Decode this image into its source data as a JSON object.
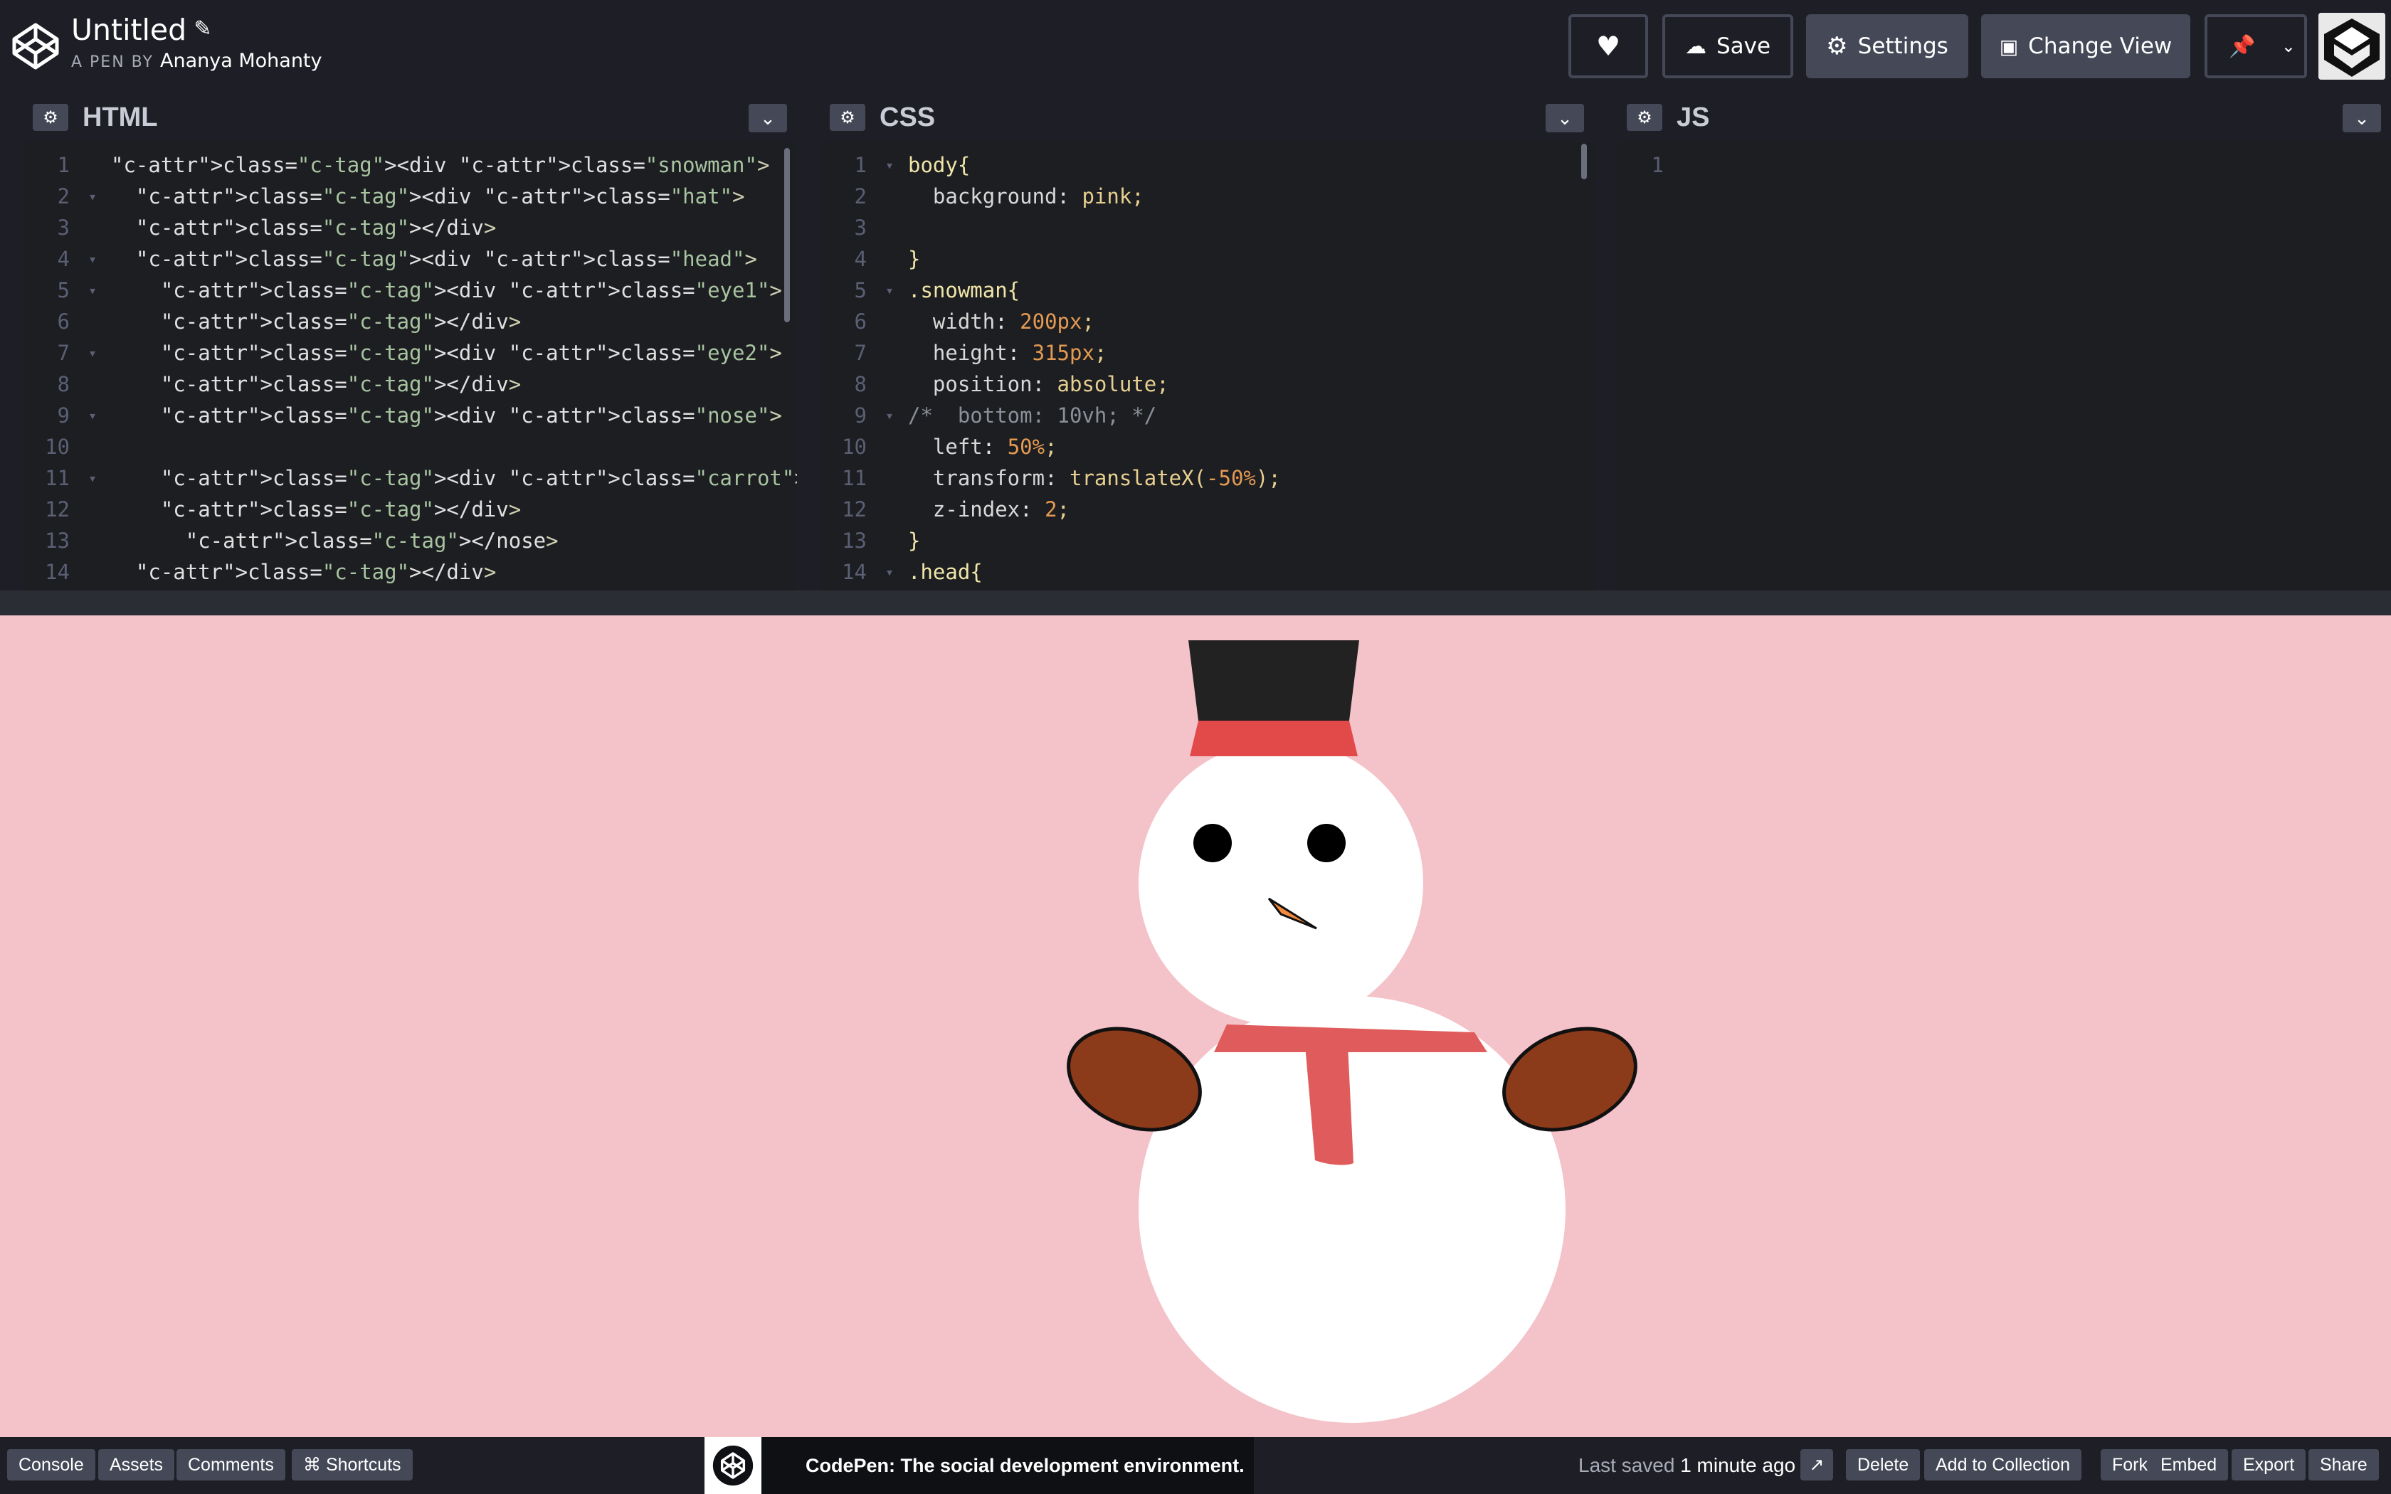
{
  "header": {
    "title": "Untitled",
    "byline_prefix": "A PEN BY",
    "author": "Ananya Mohanty",
    "buttons": {
      "save": "Save",
      "settings": "Settings",
      "change_view": "Change View"
    },
    "icons": [
      "heart-icon",
      "cloud-icon",
      "gear-icon",
      "eye-icon",
      "pin-icon",
      "chevron-down-icon"
    ]
  },
  "panes": {
    "html": {
      "title": "HTML",
      "lines": [
        {
          "n": "1",
          "fold": "",
          "t": "<div class=\"snowman\">"
        },
        {
          "n": "2",
          "fold": "▾",
          "t": "  <div class=\"hat\">"
        },
        {
          "n": "3",
          "fold": "",
          "t": "  </div>"
        },
        {
          "n": "4",
          "fold": "▾",
          "t": "  <div class=\"head\">"
        },
        {
          "n": "5",
          "fold": "▾",
          "t": "    <div class=\"eye1\">"
        },
        {
          "n": "6",
          "fold": "",
          "t": "    </div>"
        },
        {
          "n": "7",
          "fold": "▾",
          "t": "    <div class=\"eye2\">"
        },
        {
          "n": "8",
          "fold": "",
          "t": "    </div>"
        },
        {
          "n": "9",
          "fold": "▾",
          "t": "    <div class=\"nose\">"
        },
        {
          "n": "10",
          "fold": "",
          "t": ""
        },
        {
          "n": "11",
          "fold": "▾",
          "t": "    <div class=\"carrot\">"
        },
        {
          "n": "12",
          "fold": "",
          "t": "    </div>"
        },
        {
          "n": "13",
          "fold": "",
          "t": "      </nose>"
        },
        {
          "n": "14",
          "fold": "",
          "t": "  </div>"
        }
      ]
    },
    "css": {
      "title": "CSS",
      "lines": [
        {
          "n": "1",
          "fold": "▾",
          "t": "body{"
        },
        {
          "n": "2",
          "fold": "",
          "t": "  background: pink;"
        },
        {
          "n": "3",
          "fold": "",
          "t": ""
        },
        {
          "n": "4",
          "fold": "",
          "t": "}"
        },
        {
          "n": "5",
          "fold": "▾",
          "t": ".snowman{"
        },
        {
          "n": "6",
          "fold": "",
          "t": "  width: 200px;"
        },
        {
          "n": "7",
          "fold": "",
          "t": "  height: 315px;"
        },
        {
          "n": "8",
          "fold": "",
          "t": "  position: absolute;"
        },
        {
          "n": "9",
          "fold": "▾",
          "t": "/*  bottom: 10vh; */"
        },
        {
          "n": "10",
          "fold": "",
          "t": "  left: 50%;"
        },
        {
          "n": "11",
          "fold": "",
          "t": "  transform: translateX(-50%);"
        },
        {
          "n": "12",
          "fold": "",
          "t": "  z-index: 2;"
        },
        {
          "n": "13",
          "fold": "",
          "t": "}"
        },
        {
          "n": "14",
          "fold": "▾",
          "t": ".head{"
        }
      ]
    },
    "js": {
      "title": "JS",
      "lines": [
        {
          "n": "1",
          "fold": "",
          "t": ""
        }
      ]
    }
  },
  "preview": {
    "background": "#f4c2c9"
  },
  "footer": {
    "console": "Console",
    "assets": "Assets",
    "comments": "Comments",
    "shortcuts": "⌘ Shortcuts",
    "notice": "CodePen: The social development environment.",
    "saved_prefix": "Last saved",
    "saved_time": "1 minute ago",
    "delete": "Delete",
    "add_to_collection": "Add to Collection",
    "fork": "Fork",
    "embed": "Embed",
    "export": "Export",
    "share": "Share"
  }
}
